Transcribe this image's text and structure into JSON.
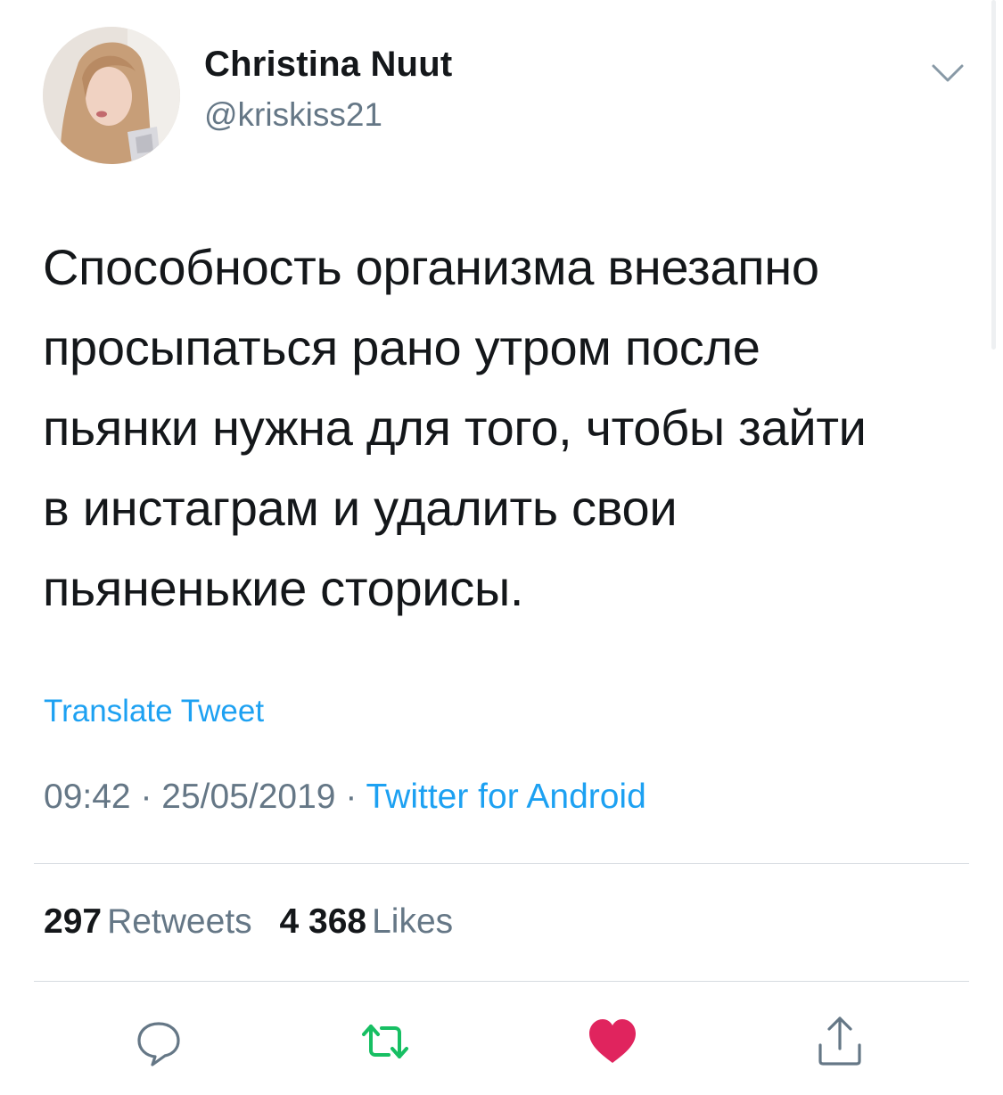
{
  "user": {
    "display_name": "Christina Nuut",
    "handle": "@kriskiss21",
    "avatar_icon": "profile-photo"
  },
  "tweet": {
    "text": "Способность организма внезапно\nпросыпаться рано утром после\nпьянки нужна для того, чтобы зайти\nв инстаграм и удалить свои\nпьяненькие сторисы.",
    "translate_label": "Translate Tweet",
    "time": "09:42",
    "date": "25/05/2019",
    "separator": "·",
    "source": "Twitter for Android"
  },
  "stats": {
    "retweets_count": "297",
    "retweets_label": "Retweets",
    "likes_count": "4 368",
    "likes_label": "Likes"
  },
  "actions": [
    {
      "icon": "reply-icon"
    },
    {
      "icon": "retweet-icon",
      "color": "#17bf63"
    },
    {
      "icon": "heart-icon",
      "color": "#e0245e"
    },
    {
      "icon": "share-icon"
    }
  ],
  "colors": {
    "link": "#1da1f2",
    "secondary_text": "#657786",
    "primary_text": "#14171a",
    "retweet_green": "#17bf63",
    "like_red": "#e0245e",
    "icon_gray": "#657786"
  }
}
